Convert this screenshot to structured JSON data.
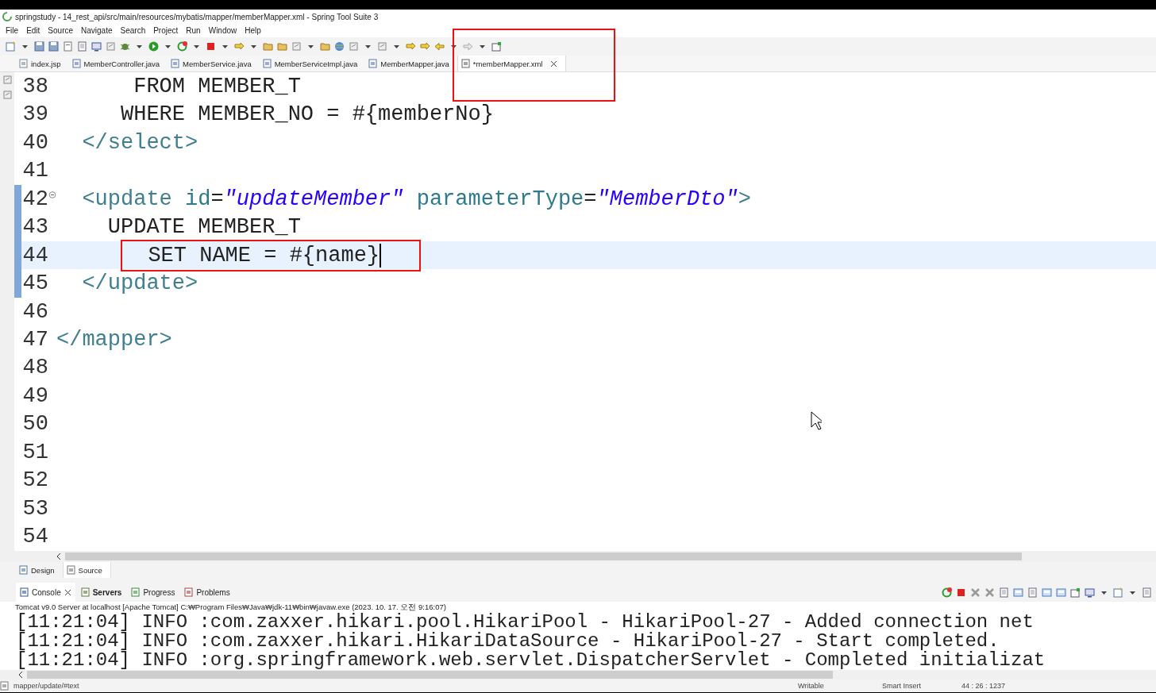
{
  "window": {
    "title": "springstudy - 14_rest_api/src/main/resources/mybatis/mapper/memberMapper.xml - Spring Tool Suite 3"
  },
  "menu": [
    "File",
    "Edit",
    "Source",
    "Navigate",
    "Search",
    "Project",
    "Run",
    "Window",
    "Help"
  ],
  "editor_tabs": [
    {
      "label": "index.jsp",
      "kind": "jsp",
      "selected": false
    },
    {
      "label": "MemberController.java",
      "kind": "java",
      "selected": false
    },
    {
      "label": "MemberService.java",
      "kind": "java",
      "selected": false
    },
    {
      "label": "MemberServiceImpl.java",
      "kind": "java",
      "selected": false
    },
    {
      "label": "MemberMapper.java",
      "kind": "java",
      "selected": false
    },
    {
      "label": "*memberMapper.xml",
      "kind": "xml",
      "selected": true
    }
  ],
  "code_lines": [
    {
      "number": "38",
      "current": false,
      "in_range": false,
      "foldable": false,
      "tokens": [
        {
          "text": "      FROM MEMBER_T",
          "kind": "plain"
        }
      ]
    },
    {
      "number": "39",
      "current": false,
      "in_range": false,
      "foldable": false,
      "tokens": [
        {
          "text": "     WHERE MEMBER_NO = #{memberNo}",
          "kind": "plain"
        }
      ]
    },
    {
      "number": "40",
      "current": false,
      "in_range": false,
      "foldable": false,
      "tokens": [
        {
          "text": "  </select>",
          "kind": "tag"
        }
      ]
    },
    {
      "number": "41",
      "current": false,
      "in_range": false,
      "foldable": false
    },
    {
      "number": "42",
      "current": false,
      "in_range": true,
      "foldable": true,
      "tokens": [
        {
          "text": "  <update",
          "kind": "tag"
        },
        {
          "text": " id",
          "kind": "attr"
        },
        {
          "text": "=",
          "kind": "plain"
        },
        {
          "text": "\"updateMember\"",
          "kind": "value"
        },
        {
          "text": " parameterType",
          "kind": "attr"
        },
        {
          "text": "=",
          "kind": "plain"
        },
        {
          "text": "\"MemberDto\"",
          "kind": "value"
        },
        {
          "text": ">",
          "kind": "tag"
        }
      ]
    },
    {
      "number": "43",
      "current": false,
      "in_range": true,
      "foldable": false,
      "tokens": [
        {
          "text": "    UPDATE MEMBER_T",
          "kind": "plain"
        }
      ]
    },
    {
      "number": "44",
      "current": true,
      "in_range": true,
      "foldable": false,
      "tokens": [
        {
          "text": "       SET NAME = #{name}",
          "kind": "plain"
        }
      ]
    },
    {
      "number": "45",
      "current": false,
      "in_range": true,
      "foldable": false,
      "tokens": [
        {
          "text": "  </update>",
          "kind": "tag"
        }
      ]
    },
    {
      "number": "46",
      "current": false,
      "in_range": false,
      "foldable": false
    },
    {
      "number": "47",
      "current": false,
      "in_range": false,
      "foldable": false,
      "tokens": [
        {
          "text": "</mapper>",
          "kind": "tag"
        }
      ]
    },
    {
      "number": "48",
      "current": false,
      "in_range": false,
      "foldable": false
    },
    {
      "number": "49",
      "current": false,
      "in_range": false,
      "foldable": false
    },
    {
      "number": "50",
      "current": false,
      "in_range": false,
      "foldable": false
    },
    {
      "number": "51",
      "current": false,
      "in_range": false,
      "foldable": false
    },
    {
      "number": "52",
      "current": false,
      "in_range": false,
      "foldable": false
    },
    {
      "number": "53",
      "current": false,
      "in_range": false,
      "foldable": false
    },
    {
      "number": "54",
      "current": false,
      "in_range": false,
      "foldable": false
    }
  ],
  "view_tabs": [
    {
      "label": "Design",
      "kind": "design",
      "selected": false
    },
    {
      "label": "Source",
      "kind": "source",
      "selected": true
    }
  ],
  "console_tabs": [
    {
      "label": "Console",
      "kind": "console",
      "selected": true,
      "bold": false
    },
    {
      "label": "Servers",
      "kind": "servers",
      "selected": false,
      "bold": true
    },
    {
      "label": "Progress",
      "kind": "progress",
      "selected": false,
      "bold": false
    },
    {
      "label": "Problems",
      "kind": "problems",
      "selected": false,
      "bold": false
    }
  ],
  "console_header": "Tomcat v9.0 Server at localhost [Apache Tomcat] C:₩Program Files₩Java₩jdk-11₩bin₩javaw.exe  (2023. 10. 17. 오전 9:16:07)",
  "console_lines": [
    "[11:21:04] INFO :com.zaxxer.hikari.pool.HikariPool - HikariPool-27 - Added connection net",
    "[11:21:04] INFO :com.zaxxer.hikari.HikariDataSource - HikariPool-27 - Start completed.",
    "[11:21:04] INFO :org.springframework.web.servlet.DispatcherServlet - Completed initializat"
  ],
  "status_bar": {
    "path": "mapper/update/#text",
    "mode": "Writable",
    "insert": "Smart Insert",
    "position": "44 : 26 : 1237"
  }
}
